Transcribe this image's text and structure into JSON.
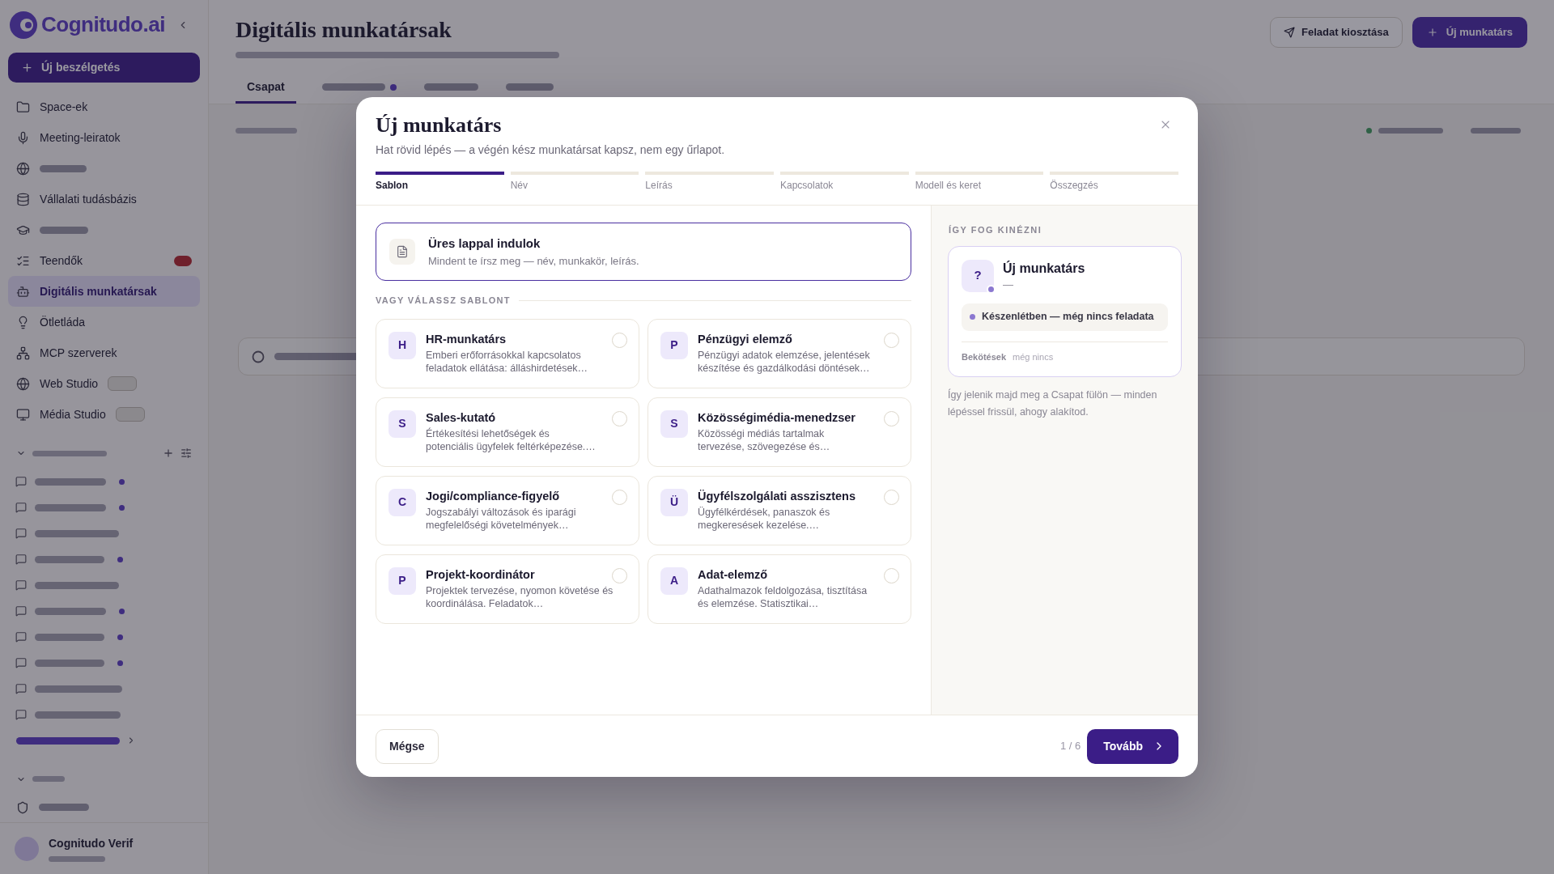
{
  "background": {
    "sidebar": {
      "logo": "Cognitudo.ai",
      "new_chat": "Új beszélgetés",
      "nav_items": [
        {
          "label": "Space-ek",
          "selected": false,
          "kind": "plain"
        },
        {
          "label": "Meeting-leiratok",
          "selected": false,
          "kind": "plain"
        },
        {
          "selected": false,
          "kind": "plain"
        },
        {
          "label": "Vállalati tudásbázis",
          "selected": false,
          "kind": "plain"
        },
        {
          "selected": false,
          "kind": "plain"
        },
        {
          "label": "Teendők",
          "selected": false,
          "kind": "alert"
        },
        {
          "label": "Digitális munkatársak",
          "selected": true,
          "kind": "plain"
        },
        {
          "label": "Ötletláda",
          "selected": false,
          "kind": "plain"
        },
        {
          "label": "MCP szerverek",
          "selected": false,
          "kind": "plain"
        },
        {
          "label": "Web Studio",
          "selected": false,
          "kind": "tag"
        },
        {
          "label": "Média Studio",
          "selected": false,
          "kind": "tag"
        }
      ],
      "conversations": [
        {
          "unread": true
        },
        {
          "unread": true
        },
        {
          "unread": false
        },
        {
          "unread": true
        },
        {
          "unread": false
        },
        {
          "unread": true
        },
        {
          "unread": true
        },
        {
          "unread": true
        },
        {
          "unread": false
        },
        {
          "unread": false
        }
      ],
      "user": {
        "name": "Cognitudo Verif"
      }
    },
    "main": {
      "title": "Digitális munkatársak",
      "actions": [
        {
          "kind": "secondary",
          "label": "Feladat kiosztása"
        },
        {
          "kind": "primary",
          "label": "Új munkatárs"
        }
      ],
      "tabs": [
        {
          "label": "Csapat",
          "selected": true
        },
        {
          "selected": false,
          "indicator": true
        },
        {
          "selected": false
        },
        {
          "selected": false
        }
      ]
    }
  },
  "dialog": {
    "title": "Új munkatárs",
    "subtitle": "Hat rövid lépés — a végén kész munkatársat kapsz, nem egy űrlapot.",
    "steps": [
      {
        "label": "Sablon",
        "selected": true
      },
      {
        "label": "Név",
        "selected": false
      },
      {
        "label": "Leírás",
        "selected": false
      },
      {
        "label": "Kapcsolatok",
        "selected": false
      },
      {
        "label": "Modell és keret",
        "selected": false
      },
      {
        "label": "Összegzés",
        "selected": false
      }
    ],
    "blank_option": {
      "title": "Üres lappal indulok",
      "description": "Mindent te írsz meg — név, munkakör, leírás.",
      "selected": true
    },
    "divider_label": "VAGY VÁLASSZ SABLONT",
    "templates": [
      {
        "initial": "H",
        "title": "HR-munkatárs",
        "description": "Emberi erőforrásokkal kapcsolatos feladatok ellátása: álláshirdetések…",
        "selected": false
      },
      {
        "initial": "P",
        "title": "Pénzügyi elemző",
        "description": "Pénzügyi adatok elemzése, jelentések készítése és gazdálkodási döntések…",
        "selected": false
      },
      {
        "initial": "S",
        "title": "Sales-kutató",
        "description": "Értékesítési lehetőségek és potenciális ügyfelek feltérképezése.…",
        "selected": false
      },
      {
        "initial": "S",
        "title": "Közösségimédia-menedzser",
        "description": "Közösségi médiás tartalmak tervezése, szövegezése és…",
        "selected": false
      },
      {
        "initial": "C",
        "title": "Jogi/compliance-figyelő",
        "description": "Jogszabályi változások és iparági megfelelőségi követelmények…",
        "selected": false
      },
      {
        "initial": "Ü",
        "title": "Ügyfélszolgálati asszisztens",
        "description": "Ügyfélkérdések, panaszok és megkeresések kezelése.…",
        "selected": false
      },
      {
        "initial": "P",
        "title": "Projekt-koordinátor",
        "description": "Projektek tervezése, nyomon követése és koordinálása. Feladatok…",
        "selected": false
      },
      {
        "initial": "A",
        "title": "Adat-elemző",
        "description": "Adathalmazok feldolgozása, tisztítása és elemzése. Statisztikai…",
        "selected": false
      }
    ],
    "preview": {
      "heading": "ÍGY FOG KINÉZNI",
      "avatar": "?",
      "name": "Új munkatárs",
      "role": "—",
      "status": "Készenlétben — még nincs feladata",
      "connections_label": "Bekötések",
      "connections_value": "még nincs",
      "caption": "Így jelenik majd meg a Csapat fülön — minden lépéssel frissül, ahogy alakítod."
    },
    "footer": {
      "cancel": "Mégse",
      "progress": "1 / 6",
      "next": "Tovább"
    }
  }
}
